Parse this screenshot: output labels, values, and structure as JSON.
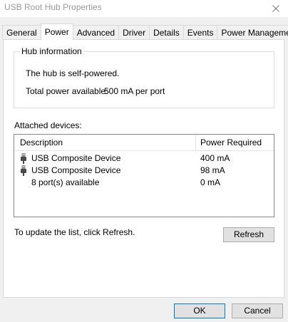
{
  "window": {
    "title": "USB Root Hub Properties"
  },
  "tabs": [
    {
      "label": "General",
      "active": false
    },
    {
      "label": "Power",
      "active": true
    },
    {
      "label": "Advanced",
      "active": false
    },
    {
      "label": "Driver",
      "active": false
    },
    {
      "label": "Details",
      "active": false
    },
    {
      "label": "Events",
      "active": false
    },
    {
      "label": "Power Management",
      "active": false
    }
  ],
  "hub_info": {
    "group_label": "Hub information",
    "self_powered": "The hub is self-powered.",
    "total_power_label": "Total power available:",
    "total_power_value": "500 mA per port"
  },
  "attached": {
    "label": "Attached devices:",
    "columns": {
      "description": "Description",
      "power": "Power Required"
    },
    "rows": [
      {
        "description": "USB Composite Device",
        "power": "400 mA",
        "icon": "usb-plug-icon"
      },
      {
        "description": "USB Composite Device",
        "power": "98 mA",
        "icon": "usb-plug-icon"
      },
      {
        "description": "8 port(s) available",
        "power": "0 mA",
        "icon": ""
      }
    ]
  },
  "footer": {
    "update_text": "To update the list, click Refresh.",
    "refresh_label": "Refresh"
  },
  "buttons": {
    "ok": "OK",
    "cancel": "Cancel"
  }
}
